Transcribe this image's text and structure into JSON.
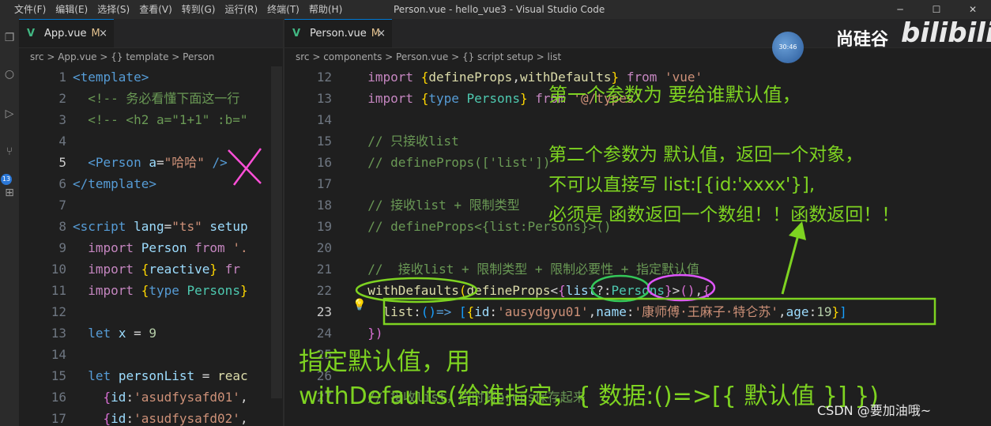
{
  "menu": [
    "文件(F)",
    "编辑(E)",
    "选择(S)",
    "查看(V)",
    "转到(G)",
    "运行(R)",
    "终端(T)",
    "帮助(H)"
  ],
  "window_title": "Person.vue - hello_vue3 - Visual Studio Code",
  "left_pane": {
    "tab": {
      "icon": "V",
      "label": "App.vue",
      "modified": "M",
      "close": "×"
    },
    "breadcrumb": "src > App.vue > {} template > Person",
    "lines": [
      {
        "n": "1",
        "html": "<span class='tag'>&lt;template&gt;</span>"
      },
      {
        "n": "2",
        "html": "  <span class='cm'>&lt;!-- 务必看懂下面这一行</span>"
      },
      {
        "n": "3",
        "html": "  <span class='cm'>&lt;!-- &lt;h2 a=\"1+1\" :b=\"</span>"
      },
      {
        "n": "4",
        "html": ""
      },
      {
        "n": "5",
        "html": "  <span class='tag'>&lt;Person</span> <span class='attr'>a</span><span class='pl'>=</span><span class='str'>\"哈哈\"</span> <span class='tag'>/&gt;</span>",
        "active": true
      },
      {
        "n": "6",
        "html": "<span class='tag'>&lt;/template&gt;</span>"
      },
      {
        "n": "7",
        "html": ""
      },
      {
        "n": "8",
        "html": "<span class='tag'>&lt;script</span> <span class='attr'>lang</span><span class='pl'>=</span><span class='str'>\"ts\"</span> <span class='attr'>setup</span>"
      },
      {
        "n": "9",
        "html": "  <span class='kw2'>import</span> <span class='var'>Person</span> <span class='kw2'>from</span> <span class='str'>'.</span>"
      },
      {
        "n": "10",
        "html": "  <span class='kw2'>import</span> <span class='br'>{</span><span class='var'>reactive</span><span class='br'>}</span> <span class='kw2'>fr</span>"
      },
      {
        "n": "11",
        "html": "  <span class='kw2'>import</span> <span class='br'>{</span><span class='kw'>type</span> <span class='type'>Persons</span><span class='br'>}</span>"
      },
      {
        "n": "12",
        "html": ""
      },
      {
        "n": "13",
        "html": "  <span class='kw'>let</span> <span class='var'>x</span> <span class='pl'>=</span> <span class='num'>9</span>"
      },
      {
        "n": "14",
        "html": ""
      },
      {
        "n": "15",
        "html": "  <span class='kw'>let</span> <span class='var'>personList</span> <span class='pl'>=</span> <span class='fn'>reac</span>"
      },
      {
        "n": "16",
        "html": "    <span class='br2'>{</span><span class='var'>id</span><span class='pl'>:</span><span class='str'>'asudfysafd01'</span><span class='pl'>,</span>"
      },
      {
        "n": "17",
        "html": "    <span class='br2'>{</span><span class='var'>id</span><span class='pl'>:</span><span class='str'>'asudfysafd02'</span><span class='pl'>,</span>"
      }
    ]
  },
  "right_pane": {
    "tab": {
      "icon": "V",
      "label": "Person.vue",
      "modified": "M",
      "close": "×"
    },
    "breadcrumb": "src > components > Person.vue > {} script setup > list",
    "lines": [
      {
        "n": "12",
        "html": "  <span class='kw2'>import</span> <span class='br'>{</span><span class='fn'>defineProps</span><span class='pl'>,</span><span class='fn'>withDefaults</span><span class='br'>}</span> <span class='kw2'>from</span> <span class='str'>'vue'</span>"
      },
      {
        "n": "13",
        "html": "  <span class='kw2'>import</span> <span class='br'>{</span><span class='kw'>type</span> <span class='type'>Persons</span><span class='br'>}</span> <span class='kw2'>from</span> <span class='str'>'@/types'</span>"
      },
      {
        "n": "14",
        "html": ""
      },
      {
        "n": "15",
        "html": "  <span class='cm'>// 只接收list</span>"
      },
      {
        "n": "16",
        "html": "  <span class='cm'>// defineProps(['list'])</span>"
      },
      {
        "n": "17",
        "html": ""
      },
      {
        "n": "18",
        "html": "  <span class='cm'>// 接收list + 限制类型</span>"
      },
      {
        "n": "19",
        "html": "  <span class='cm'>// defineProps&lt;{list:Persons}&gt;()</span>"
      },
      {
        "n": "20",
        "html": ""
      },
      {
        "n": "21",
        "html": "  <span class='cm'>//  接收list + 限制类型 + 限制必要性 + 指定默认值</span>"
      },
      {
        "n": "22",
        "html": "  <span class='fn'>withDefaults</span><span class='br'>(</span><span class='fn'>defineProps</span><span class='pl'>&lt;</span><span class='br2'>{</span><span class='var'>list</span><span class='pl'>?:</span><span class='type'>Persons</span><span class='br2'>}</span><span class='pl'>&gt;</span><span class='br2'>()</span><span class='pl'>,</span><span class='br2'>{</span>"
      },
      {
        "n": "23",
        "html": "    <span class='fn'>list</span><span class='pl'>:</span><span class='br3'>()</span><span class='kw'>=&gt;</span> <span class='br3'>[</span><span class='br'>{</span><span class='var'>id</span><span class='pl'>:</span><span class='str'>'ausydgyu01'</span><span class='pl'>,</span><span class='var'>name</span><span class='pl'>:</span><span class='str'>'康师傅·王麻子·特仑苏'</span><span class='pl'>,</span><span class='var'>age</span><span class='pl'>:</span><span class='num'>19</span><span class='br'>}</span><span class='br3'>]</span>",
        "active": true
      },
      {
        "n": "24",
        "html": "  <span class='br2'>})</span>"
      },
      {
        "n": "25",
        "html": ""
      },
      {
        "n": "26",
        "html": ""
      },
      {
        "n": "27",
        "html": "  <span class='cm'>// 接收list，同时将props保存起来</span>"
      }
    ]
  },
  "annotations": {
    "a1": "第一个参数为 要给谁默认值，",
    "a2": "第二个参数为 默认值，返回一个对象，",
    "a3": "不可以直接写 list:[{id:'xxxx'}],",
    "a4": "必须是 函数返回一个数组！！函数返回！！",
    "a5": "指定默认值，用",
    "a6": "withDefaults(给谁指定，{ 数据:()=>[{ 默认值 }] })"
  },
  "watermark": {
    "brand": "尚硅谷",
    "bili": "bilibili",
    "csdn": "CSDN @要加油哦~",
    "clock": "30:46"
  },
  "colors": {
    "accent": "#0078d4",
    "annotation": "#7ed321"
  }
}
